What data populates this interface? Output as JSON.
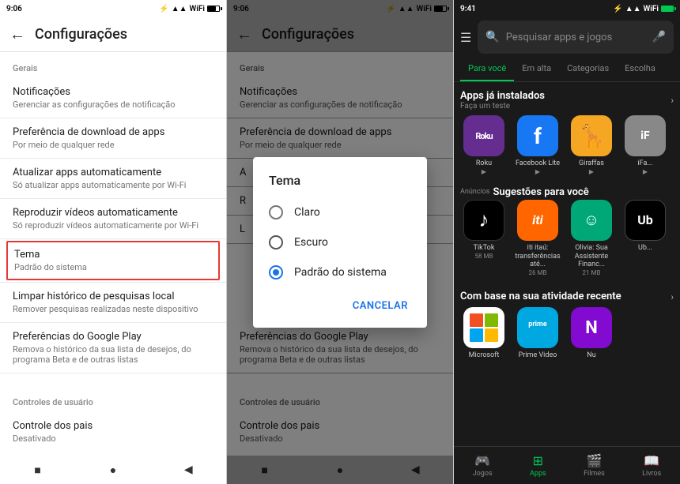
{
  "panel1": {
    "statusbar": {
      "time": "9:06",
      "icons": "bluetooth signal wifi battery"
    },
    "title": "Configurações",
    "back": "←",
    "sections": [
      {
        "header": "Gerais",
        "items": [
          {
            "title": "Notificações",
            "subtitle": "Gerenciar as configurações de notificação",
            "highlighted": false
          },
          {
            "title": "Preferência de download de apps",
            "subtitle": "Por meio de qualquer rede",
            "highlighted": false
          },
          {
            "title": "Atualizar apps automaticamente",
            "subtitle": "Só atualizar apps automaticamente por Wi-Fi",
            "highlighted": false
          },
          {
            "title": "Reproduzir vídeos automaticamente",
            "subtitle": "Só reproduzir vídeos automaticamente por Wi-Fi",
            "highlighted": false
          },
          {
            "title": "Tema",
            "subtitle": "Padrão do sistema",
            "highlighted": true
          },
          {
            "title": "Limpar histórico de pesquisas local",
            "subtitle": "Remover pesquisas realizadas neste dispositivo",
            "highlighted": false
          },
          {
            "title": "Preferências do Google Play",
            "subtitle": "Remova o histórico da sua lista de desejos, do programa Beta e de outras listas",
            "highlighted": false
          }
        ]
      },
      {
        "header": "Controles de usuário",
        "items": [
          {
            "title": "Controle dos pais",
            "subtitle": "Desativado",
            "highlighted": false
          }
        ]
      }
    ],
    "nav": [
      "■",
      "●",
      "◀"
    ]
  },
  "panel2": {
    "statusbar": {
      "time": "9:06"
    },
    "title": "Configurações",
    "modal": {
      "title": "Tema",
      "options": [
        {
          "label": "Claro",
          "selected": false
        },
        {
          "label": "Escuro",
          "selected": false
        },
        {
          "label": "Padrão do sistema",
          "selected": true
        }
      ],
      "cancel_label": "CANCELAR"
    },
    "nav": [
      "■",
      "●",
      "◀"
    ]
  },
  "panel3": {
    "statusbar": {
      "time": "9:41"
    },
    "search_placeholder": "Pesquisar apps e jogos",
    "tabs": [
      "Para você",
      "Em alta",
      "Categorias",
      "Escolha"
    ],
    "active_tab": "Para você",
    "section1": {
      "title": "Apps já instalados",
      "subtitle": "Faça um teste",
      "apps": [
        {
          "name": "Roku",
          "icon": "roku",
          "letter": "ROKU"
        },
        {
          "name": "Facebook Lite",
          "icon": "fb",
          "letter": "f"
        },
        {
          "name": "Giraffas",
          "icon": "giraffas",
          "letter": "🦒"
        },
        {
          "name": "iFa...",
          "icon": "ifa",
          "letter": "iF"
        }
      ]
    },
    "section2": {
      "ads_label": "Anúncios",
      "title": "Sugestões para você",
      "apps": [
        {
          "name": "TikTok",
          "size": "58 MB",
          "icon": "tiktok"
        },
        {
          "name": "iti itaú: transferências até...",
          "size": "26 MB",
          "icon": "iti"
        },
        {
          "name": "Olivia: Sua Assistente Financ...",
          "size": "21 MB",
          "icon": "olivia"
        },
        {
          "name": "Ub...",
          "size": "",
          "icon": "uber"
        }
      ]
    },
    "section3": {
      "title": "Com base na sua atividade recente",
      "apps": [
        {
          "name": "Microsoft",
          "icon": "ms"
        },
        {
          "name": "Prime Video",
          "icon": "prime"
        },
        {
          "name": "Nu",
          "icon": "nu"
        }
      ]
    },
    "bottom_nav": [
      {
        "label": "Jogos",
        "icon": "🎮",
        "active": false
      },
      {
        "label": "Apps",
        "icon": "⊞",
        "active": true
      },
      {
        "label": "Filmes",
        "icon": "🎬",
        "active": false
      },
      {
        "label": "Livros",
        "icon": "📖",
        "active": false
      }
    ]
  }
}
